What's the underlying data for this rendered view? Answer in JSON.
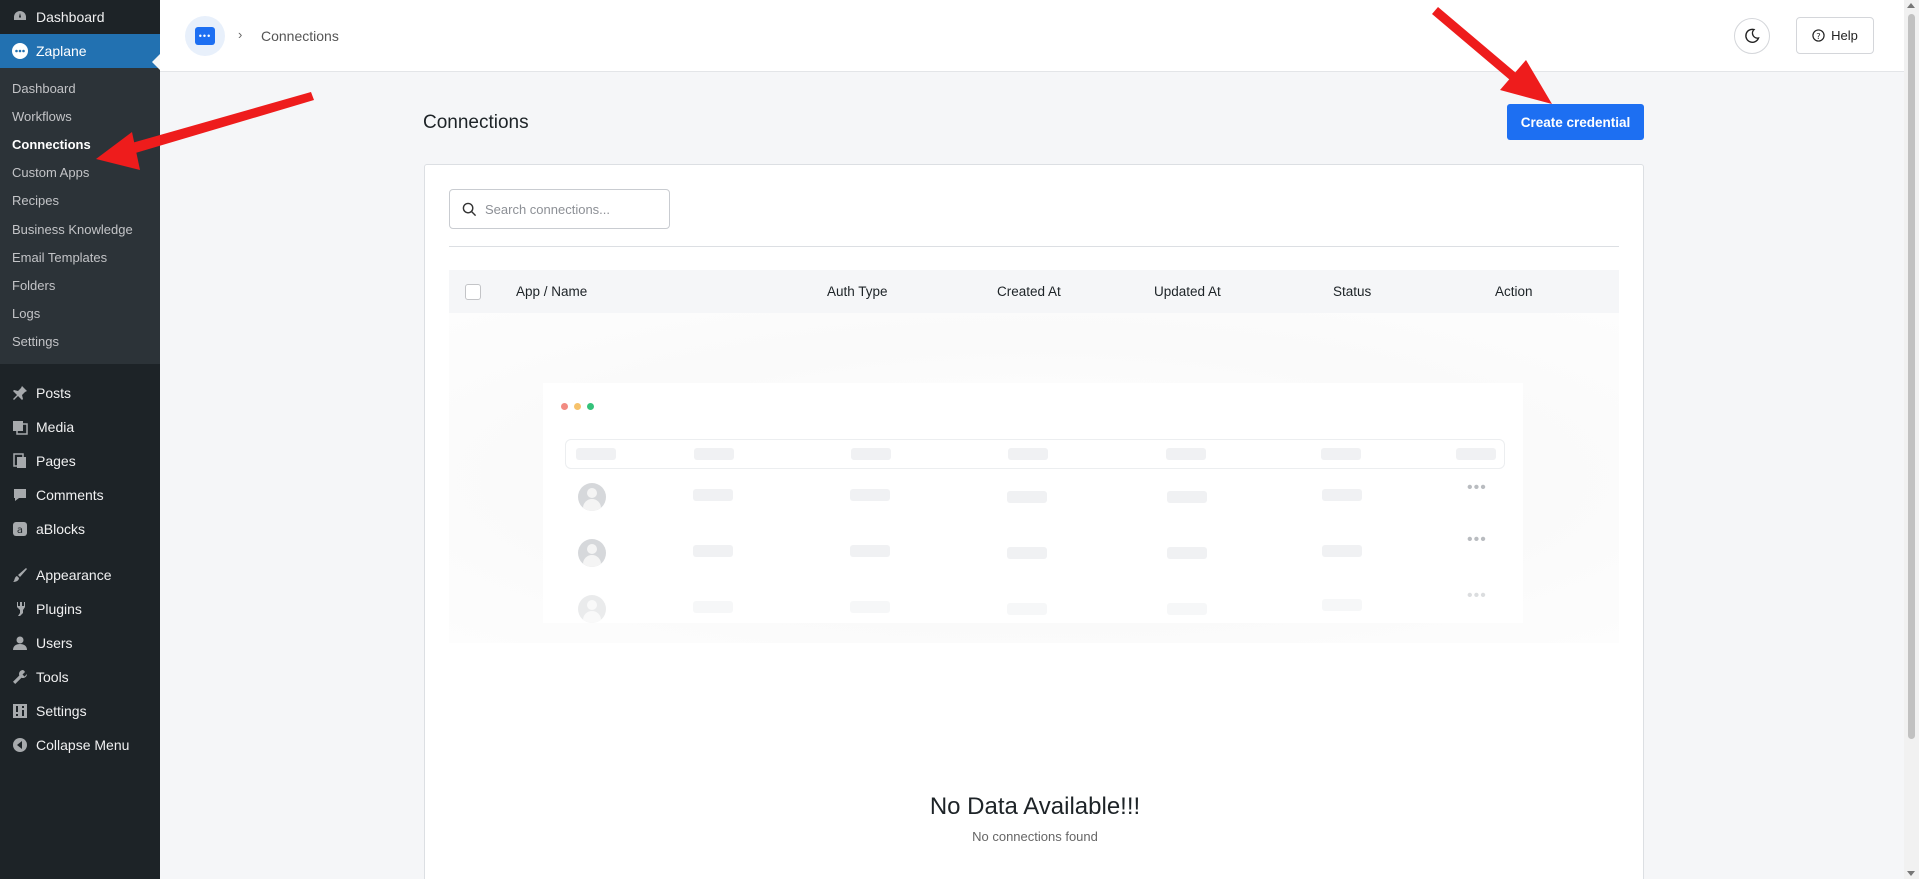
{
  "sidebar": {
    "top_dashboard": "Dashboard",
    "zaplane": "Zaplane",
    "sub": [
      "Dashboard",
      "Workflows",
      "Connections",
      "Custom Apps",
      "Recipes",
      "Business Knowledge",
      "Email Templates",
      "Folders",
      "Logs",
      "Settings"
    ],
    "active_sub": "Connections",
    "items": [
      {
        "label": "Posts",
        "icon": "pin-icon"
      },
      {
        "label": "Media",
        "icon": "media-icon"
      },
      {
        "label": "Pages",
        "icon": "pages-icon"
      },
      {
        "label": "Comments",
        "icon": "comments-icon"
      },
      {
        "label": "aBlocks",
        "icon": "ablocks-icon"
      }
    ],
    "items2": [
      {
        "label": "Appearance",
        "icon": "brush-icon"
      },
      {
        "label": "Plugins",
        "icon": "plugin-icon"
      },
      {
        "label": "Users",
        "icon": "user-icon"
      },
      {
        "label": "Tools",
        "icon": "wrench-icon"
      },
      {
        "label": "Settings",
        "icon": "settings-icon"
      },
      {
        "label": "Collapse Menu",
        "icon": "collapse-icon"
      }
    ],
    "bg_color": "#1d2327",
    "accent_color": "#2271b1"
  },
  "header": {
    "breadcrumb": "Connections",
    "help_label": "Help"
  },
  "page": {
    "title": "Connections",
    "create_label": "Create credential",
    "accent_color": "#1d6ff2"
  },
  "search": {
    "placeholder": "Search connections..."
  },
  "table": {
    "columns": [
      "App / Name",
      "Auth Type",
      "Created At",
      "Updated At",
      "Status",
      "Action"
    ]
  },
  "empty": {
    "title": "No Data Available!!!",
    "subtitle": "No connections found"
  }
}
